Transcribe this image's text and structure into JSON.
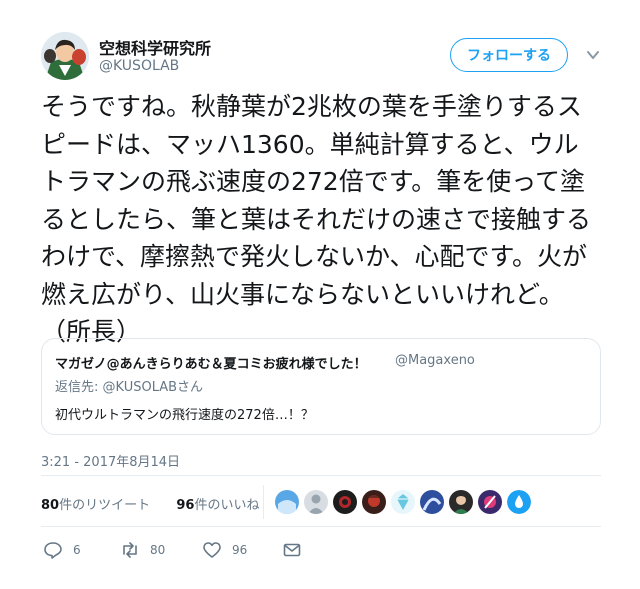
{
  "author": {
    "name": "空想科学研究所",
    "handle": "@KUSOLAB"
  },
  "follow_label": "フォローする",
  "tweet": {
    "text": "そうですね。秋静葉が2兆枚の葉を手塗りするスピードは、マッハ1360。単純計算すると、ウルトラマンの飛ぶ速度の272倍です。筆を使って塗るとしたら、筆と葉はそれだけの速さで接触するわけで、摩擦熱で発火しないか、心配です。火が燃え広がり、山火事にならないといいけれど。（所長）"
  },
  "quoted": {
    "name": "マガゼノ@あんきらりあむ＆夏コミお疲れ様でした！",
    "handle": "@Magaxeno",
    "reply_to": "返信先: @KUSOLABさん",
    "text": "初代ウルトラマンの飛行速度の272倍…！？"
  },
  "timestamp": "3:21 - 2017年8月14日",
  "stats": {
    "retweet_count": "80",
    "retweet_label": "件のリツイート",
    "like_count": "96",
    "like_label": "件のいいね"
  },
  "likers": [
    "user-avatar",
    "user-avatar",
    "user-avatar",
    "user-avatar",
    "user-avatar",
    "user-avatar",
    "user-avatar",
    "user-avatar",
    "user-avatar"
  ],
  "actions": {
    "reply_count": "6",
    "retweet_count": "80",
    "like_count": "96"
  },
  "colors": {
    "accent": "#1da1f2",
    "muted": "#657786",
    "border": "#e1e8ed"
  }
}
